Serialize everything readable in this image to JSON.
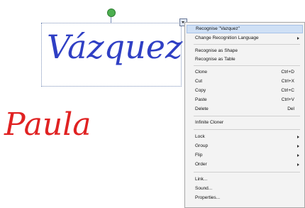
{
  "ink": {
    "word_1": "Vázquez",
    "word_2": "Paula",
    "color_word_1": "#2f3fc4",
    "color_word_2": "#e02222"
  },
  "context_menu": {
    "items": [
      {
        "label": "Recognise \"Vazquez\"",
        "shortcut": "",
        "submenu": false,
        "highlighted": true
      },
      {
        "label": "Change Recognition Language",
        "shortcut": "",
        "submenu": true
      },
      {
        "label": "Recognise as Shape",
        "shortcut": "",
        "submenu": false
      },
      {
        "label": "Recognise as Table",
        "shortcut": "",
        "submenu": false
      },
      {
        "label": "Clone",
        "shortcut": "Ctrl+D",
        "submenu": false
      },
      {
        "label": "Cut",
        "shortcut": "Ctrl+X",
        "submenu": false
      },
      {
        "label": "Copy",
        "shortcut": "Ctrl+C",
        "submenu": false
      },
      {
        "label": "Paste",
        "shortcut": "Ctrl+V",
        "submenu": false
      },
      {
        "label": "Delete",
        "shortcut": "Del",
        "submenu": false
      },
      {
        "label": "Infinite Cloner",
        "shortcut": "",
        "submenu": false
      },
      {
        "label": "Lock",
        "shortcut": "",
        "submenu": true
      },
      {
        "label": "Group",
        "shortcut": "",
        "submenu": true
      },
      {
        "label": "Flip",
        "shortcut": "",
        "submenu": true
      },
      {
        "label": "Order",
        "shortcut": "",
        "submenu": true
      },
      {
        "label": "Link...",
        "shortcut": "",
        "submenu": false
      },
      {
        "label": "Sound...",
        "shortcut": "",
        "submenu": false
      },
      {
        "label": "Properties...",
        "shortcut": "",
        "submenu": false
      }
    ]
  }
}
